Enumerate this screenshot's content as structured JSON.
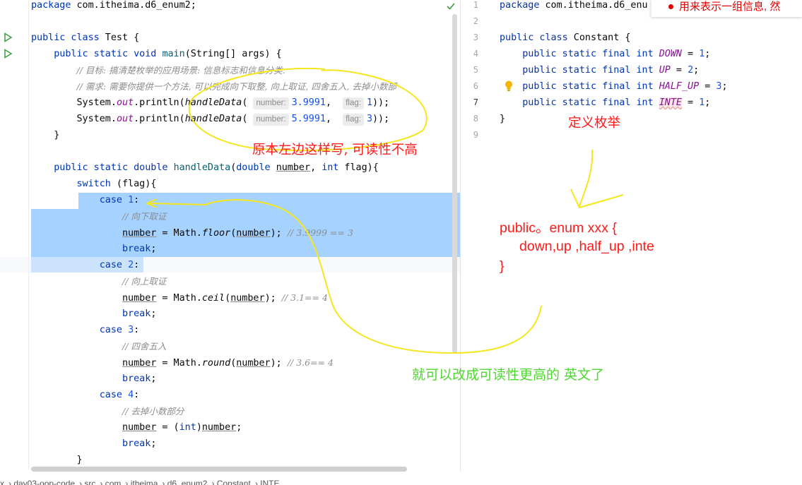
{
  "left_editor": {
    "lines": [
      {
        "segments": [
          [
            "kw",
            "package"
          ],
          [
            "",
            " com.itheima.d6_enum2;"
          ]
        ]
      },
      {
        "segments": []
      },
      {
        "segments": [
          [
            "kw",
            "public class"
          ],
          [
            "",
            " Test {"
          ]
        ]
      },
      {
        "segments": [
          [
            "",
            "    "
          ],
          [
            "kw",
            "public static void"
          ],
          [
            "",
            " "
          ],
          [
            "fn",
            "main"
          ],
          [
            "",
            "(String[] args) {"
          ]
        ]
      },
      {
        "segments": [
          [
            "",
            "        "
          ],
          [
            "cmt",
            "// 目标: 搞清楚枚举的应用场景: 信息标志和信息分类."
          ]
        ]
      },
      {
        "segments": [
          [
            "",
            "        "
          ],
          [
            "cmt",
            "// 需求: 需要你提供一个方法, 可以完成向下取整, 向上取证, 四舍五入, 去掉小数部"
          ]
        ]
      },
      {
        "segments": [
          [
            "",
            "        System."
          ],
          [
            "fld",
            "out"
          ],
          [
            "",
            ".println("
          ],
          [
            "ital",
            "handleData"
          ],
          [
            "",
            "( "
          ],
          [
            "hint",
            "number:"
          ],
          [
            "num",
            "3.9991"
          ],
          [
            "",
            ",  "
          ],
          [
            "hint",
            "flag:"
          ],
          [
            "num",
            "1"
          ],
          [
            "",
            "));"
          ]
        ]
      },
      {
        "segments": [
          [
            "",
            "        System."
          ],
          [
            "fld",
            "out"
          ],
          [
            "",
            ".println("
          ],
          [
            "ital",
            "handleData"
          ],
          [
            "",
            "( "
          ],
          [
            "hint",
            "number:"
          ],
          [
            "num",
            "5.9991"
          ],
          [
            "",
            ",  "
          ],
          [
            "hint",
            "flag:"
          ],
          [
            "num",
            "3"
          ],
          [
            "",
            "));"
          ]
        ]
      },
      {
        "segments": [
          [
            "",
            "    }"
          ]
        ]
      },
      {
        "segments": []
      },
      {
        "segments": [
          [
            "",
            "    "
          ],
          [
            "kw",
            "public static double"
          ],
          [
            "",
            " "
          ],
          [
            "fn",
            "handleData"
          ],
          [
            "",
            "("
          ],
          [
            "kw",
            "double"
          ],
          [
            "",
            " "
          ],
          [
            "ul",
            "number"
          ],
          [
            "",
            ", "
          ],
          [
            "kw",
            "int"
          ],
          [
            "",
            " flag){"
          ]
        ]
      },
      {
        "segments": [
          [
            "",
            "        "
          ],
          [
            "kw",
            "switch"
          ],
          [
            "",
            " (flag){"
          ]
        ]
      },
      {
        "segments": [
          [
            "",
            "            "
          ],
          [
            "kw",
            "case"
          ],
          [
            "",
            " "
          ],
          [
            "num",
            "1"
          ],
          [
            "",
            ":"
          ]
        ]
      },
      {
        "segments": [
          [
            "",
            "                "
          ],
          [
            "cmt",
            "// 向下取证"
          ]
        ]
      },
      {
        "segments": [
          [
            "",
            "                "
          ],
          [
            "ul",
            "number"
          ],
          [
            "",
            " = Math."
          ],
          [
            "ital",
            "floor"
          ],
          [
            "",
            "("
          ],
          [
            "ul",
            "number"
          ],
          [
            "",
            "); "
          ],
          [
            "cmt",
            "// 3.9999 == 3"
          ]
        ]
      },
      {
        "segments": [
          [
            "",
            "                "
          ],
          [
            "kw",
            "break"
          ],
          [
            "",
            ";"
          ]
        ]
      },
      {
        "segments": [
          [
            "",
            "            "
          ],
          [
            "kw",
            "case"
          ],
          [
            "",
            " "
          ],
          [
            "num",
            "2"
          ],
          [
            "",
            ":"
          ]
        ]
      },
      {
        "segments": [
          [
            "",
            "                "
          ],
          [
            "cmt",
            "// 向上取证"
          ]
        ]
      },
      {
        "segments": [
          [
            "",
            "                "
          ],
          [
            "ul",
            "number"
          ],
          [
            "",
            " = Math."
          ],
          [
            "ital",
            "ceil"
          ],
          [
            "",
            "("
          ],
          [
            "ul",
            "number"
          ],
          [
            "",
            "); "
          ],
          [
            "cmt",
            "// 3.1== 4"
          ]
        ]
      },
      {
        "segments": [
          [
            "",
            "                "
          ],
          [
            "kw",
            "break"
          ],
          [
            "",
            ";"
          ]
        ]
      },
      {
        "segments": [
          [
            "",
            "            "
          ],
          [
            "kw",
            "case"
          ],
          [
            "",
            " "
          ],
          [
            "num",
            "3"
          ],
          [
            "",
            ":"
          ]
        ]
      },
      {
        "segments": [
          [
            "",
            "                "
          ],
          [
            "cmt",
            "// 四舍五入"
          ]
        ]
      },
      {
        "segments": [
          [
            "",
            "                "
          ],
          [
            "ul",
            "number"
          ],
          [
            "",
            " = Math."
          ],
          [
            "ital",
            "round"
          ],
          [
            "",
            "("
          ],
          [
            "ul",
            "number"
          ],
          [
            "",
            "); "
          ],
          [
            "cmt",
            "// 3.6== 4"
          ]
        ]
      },
      {
        "segments": [
          [
            "",
            "                "
          ],
          [
            "kw",
            "break"
          ],
          [
            "",
            ";"
          ]
        ]
      },
      {
        "segments": [
          [
            "",
            "            "
          ],
          [
            "kw",
            "case"
          ],
          [
            "",
            " "
          ],
          [
            "num",
            "4"
          ],
          [
            "",
            ":"
          ]
        ]
      },
      {
        "segments": [
          [
            "",
            "                "
          ],
          [
            "cmt",
            "// 去掉小数部分"
          ]
        ]
      },
      {
        "segments": [
          [
            "",
            "                "
          ],
          [
            "ul",
            "number"
          ],
          [
            "",
            " = ("
          ],
          [
            "kw",
            "int"
          ],
          [
            "",
            ")"
          ],
          [
            "ul",
            "number"
          ],
          [
            "",
            ";"
          ]
        ]
      },
      {
        "segments": [
          [
            "",
            "                "
          ],
          [
            "kw",
            "break"
          ],
          [
            "",
            ";"
          ]
        ]
      },
      {
        "segments": [
          [
            "",
            "        }"
          ]
        ]
      }
    ]
  },
  "right_editor": {
    "line_numbers": [
      "1",
      "2",
      "3",
      "4",
      "5",
      "6",
      "7",
      "8",
      "9"
    ],
    "current_line": "7",
    "lines": [
      {
        "segments": [
          [
            "kw",
            "package"
          ],
          [
            "",
            " com.itheima.d6_enu"
          ]
        ]
      },
      {
        "segments": []
      },
      {
        "segments": [
          [
            "kw",
            "public class"
          ],
          [
            "",
            " Constant {"
          ]
        ]
      },
      {
        "segments": [
          [
            "",
            "    "
          ],
          [
            "kw",
            "public static final int"
          ],
          [
            "",
            " "
          ],
          [
            "const",
            "DOWN"
          ],
          [
            "",
            " = "
          ],
          [
            "num",
            "1"
          ],
          [
            "",
            ";"
          ]
        ]
      },
      {
        "segments": [
          [
            "",
            "    "
          ],
          [
            "kw",
            "public static final int"
          ],
          [
            "",
            " "
          ],
          [
            "const",
            "UP"
          ],
          [
            "",
            " = "
          ],
          [
            "num",
            "2"
          ],
          [
            "",
            ";"
          ]
        ]
      },
      {
        "segments": [
          [
            "",
            "    "
          ],
          [
            "kw",
            "public static final int"
          ],
          [
            "",
            " "
          ],
          [
            "const",
            "HALF_UP"
          ],
          [
            "",
            " = "
          ],
          [
            "num",
            "3"
          ],
          [
            "",
            ";"
          ]
        ]
      },
      {
        "segments": [
          [
            "",
            "    "
          ],
          [
            "kw",
            "public static final int"
          ],
          [
            "",
            " "
          ],
          [
            "inte",
            "INTE"
          ],
          [
            "",
            " = "
          ],
          [
            "num",
            "1"
          ],
          [
            "",
            ";"
          ]
        ]
      },
      {
        "segments": [
          [
            "",
            "}"
          ]
        ]
      },
      {
        "segments": []
      }
    ]
  },
  "tooltip": {
    "text": "用来表示一组信息, 然"
  },
  "breadcrumb": {
    "items": [
      "x",
      "day03-oop-code",
      "src",
      "com",
      "itheima",
      "d6_enum2",
      "Constant",
      "INTE"
    ]
  },
  "annotations": {
    "note_left": "原本左边这样写, 可读性不高",
    "note_define": "定义枚举",
    "note_enum_line1": "public。enum xxx {",
    "note_enum_line2": "down,up ,half_up ,inte",
    "note_enum_line3": "}",
    "note_bottom": "就可以改成可读性更高的 英文了"
  },
  "colors": {
    "keyword": "#0033b3",
    "number": "#1750eb",
    "comment": "#8c8c8c",
    "selection": "#a6d2ff",
    "annotation_red": "#ff1a1a",
    "annotation_green": "#4ed82f",
    "annotation_yellow": "#f5e61e"
  }
}
